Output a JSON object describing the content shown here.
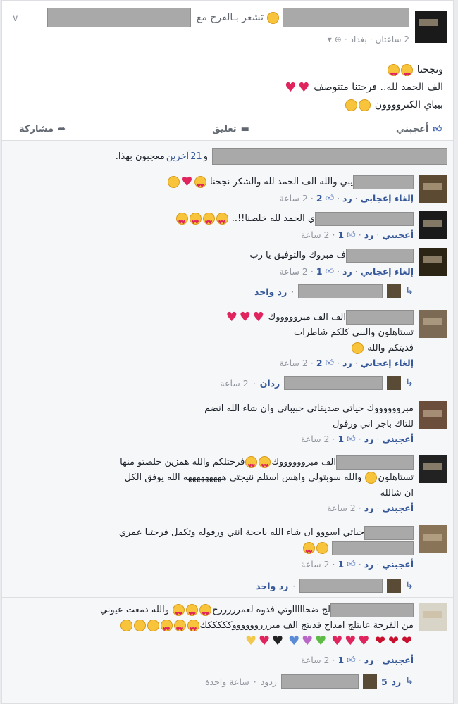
{
  "header": {
    "feeling_text": "تشعر بـالفرح مع",
    "time": "2 ساعتان",
    "location": "بغداد",
    "dot": "·"
  },
  "post": {
    "line1": "ونجحنا",
    "line2": "الف الحمد لله.. فرحتنا متنوصف",
    "line3": "بيباي الكتروووون"
  },
  "actions": {
    "like": "أعجبني",
    "comment": "تعليق",
    "share": "مشاركة"
  },
  "likes_summary": {
    "prefix": "و",
    "count": "21",
    "others": "آخرين",
    "suffix": "معجبون بهذا."
  },
  "comments": [
    {
      "text": "يبي والله الف الحمد لله والشكر نجحنا",
      "unlike": "إلغاء إعجابي",
      "reply": "رد",
      "likes": "2",
      "time": "2 ساعة"
    },
    {
      "text": "ي الحمد لله خلصنا!!..",
      "like": "أعجبني",
      "reply": "رد",
      "likes": "1",
      "time": "2 ساعة"
    },
    {
      "text": "ف مبروك والتوفيق يا رب",
      "unlike": "إلغاء إعجابي",
      "reply": "رد",
      "likes": "1",
      "time": "2 ساعة",
      "replies": "رد واحد"
    },
    {
      "text": "الف الف مبروووووك",
      "text2": "تستاهلون والنبي كلكم شاطرات",
      "text3": "فديتكم والله",
      "unlike": "إلغاء إعجابي",
      "reply": "رد",
      "likes": "2",
      "time": "2 ساعة",
      "reply_meta": "ردان",
      "reply_time": "2 ساعة"
    },
    {
      "text": "مبرووووووك حياتي صديقاتي حبيباتي وان شاء الله انضم",
      "text2": "للتاك باجر اني ورفول",
      "like": "أعجبني",
      "reply": "رد",
      "likes": "1",
      "time": "2 ساعة"
    },
    {
      "text": "الف مبرووووووك",
      "text_b": "فرحتلكم والله همزين خلصتو منها",
      "text2": "تستاهلون",
      "text2b": "والله سوبتولي واهس استلم نتيجتي هههههههههه الله يوفق الكل",
      "text3": "ان شالله",
      "like": "أعجبني",
      "reply": "رد",
      "time": "2 ساعة"
    },
    {
      "text": "حياتي اسووو ان شاء الله ناجحة انتي ورفوله وتكمل فرحتنا عمري",
      "like": "أعجبني",
      "reply": "رد",
      "likes": "1",
      "time": "2 ساعة",
      "replies": "رد واحد"
    },
    {
      "text": "لج ضحاااااوتي فدوة لعمرررررج",
      "text_b": "والله دمعت عيوني",
      "text2": "من الفرحة عابتلج امداج فديتج الف مبرررووووووكككككك",
      "like": "أعجبني",
      "reply": "رد",
      "likes": "1",
      "time": "2 ساعة",
      "reply_count": "5",
      "reply_word": "رد",
      "replies_word": "ردود",
      "reply_time": "ساعة واحدة"
    }
  ]
}
